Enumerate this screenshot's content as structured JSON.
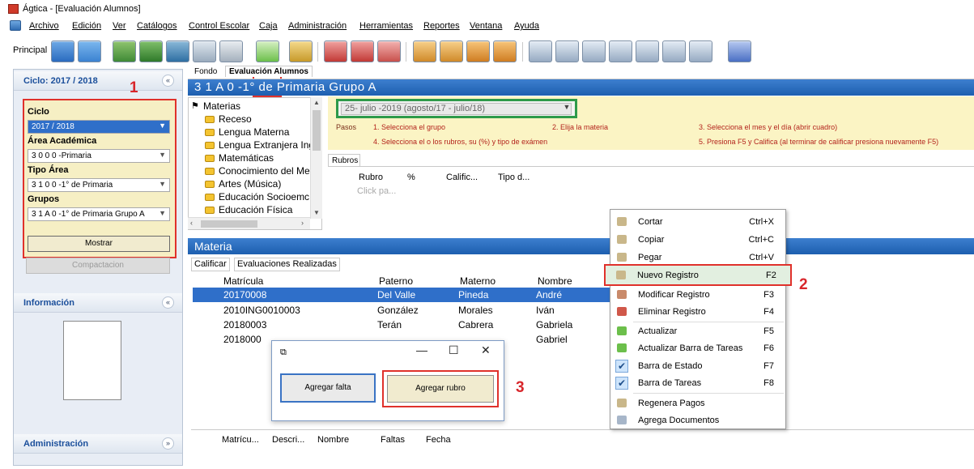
{
  "window": {
    "title": "Ágtica - [Evaluación Alumnos]"
  },
  "menu": [
    "Archivo",
    "Edición",
    "Ver",
    "Catálogos",
    "Control Escolar",
    "Caja",
    "Administración",
    "Herramientas",
    "Reportes",
    "Ventana",
    "Ayuda"
  ],
  "toolbar": {
    "label": "Principal"
  },
  "left_panel": {
    "cycle_header": "Ciclo: 2017 / 2018",
    "fields": {
      "ciclo_label": "Ciclo",
      "ciclo_value": "2017 / 2018",
      "area_label": "Área Académica",
      "area_value": "3 0 0 0 -Primaria",
      "tipo_label": "Tipo Área",
      "tipo_value": "3 1 0 0 -1° de Primaria",
      "grupos_label": "Grupos",
      "grupos_value": "3 1 A 0 -1° de Primaria Grupo A"
    },
    "mostrar": "Mostrar",
    "compactacion": "Compactacion",
    "info_header": "Información",
    "admin_header": "Administración"
  },
  "annotations": {
    "one": "1",
    "two": "2",
    "three": "3"
  },
  "main": {
    "tabs": [
      "Fondo",
      "Evaluación Alumnos"
    ],
    "group_header": "3 1 A 0 -1° de Primaria Grupo A",
    "tree_root": "Materias",
    "tree_items": [
      "Receso",
      "Lengua Materna",
      "Lengua Extranjera Ing",
      "Matemáticas",
      "Conocimiento del Me",
      "Artes (Música)",
      "Educación Socioemc",
      "Educación Física"
    ],
    "date_select": "25-     julio     -2019 (agosto/17 - julio/18)",
    "steps": {
      "pasos": "Pasos",
      "s1": "1.   Selecciona el grupo",
      "s2": "2.   Elija la materia",
      "s3": "3.     Selecciona el mes y el día (abrir cuadro)",
      "s4": "4.   Selecciona el o los rubros, su (%) y tipo de exámen",
      "s5": "5.   Presiona F5 y Califica (al terminar de calificar presiona nuevamente F5)"
    },
    "rubros_tab": "Rubros",
    "rubros_columns": [
      "Rubro",
      "%",
      "Calific...",
      "Tipo d..."
    ],
    "rubros_click": "Click pa...",
    "materia_header": "Materia",
    "subtabs": [
      "Calificar",
      "Evaluaciones Realizadas"
    ],
    "grid_columns": [
      "Matrícula",
      "Paterno",
      "Materno",
      "Nombre"
    ],
    "grid_rows": [
      [
        "20170008",
        "Del Valle",
        "Pineda",
        "André"
      ],
      [
        "2010ING0010003",
        "González",
        "Morales",
        "Iván"
      ],
      [
        "20180003",
        "Terán",
        "Cabrera",
        "Gabriela"
      ],
      [
        "2018000",
        "",
        "",
        "Gabriel"
      ]
    ],
    "bottom_columns": [
      "Matrícu...",
      "Descri...",
      "Nombre",
      "Faltas",
      "Fecha"
    ]
  },
  "dialog": {
    "minimize": "—",
    "maximize": "☐",
    "close": "✕",
    "agregar_falta": "Agregar falta",
    "agregar_rubro": "Agregar rubro"
  },
  "context_menu": {
    "items": [
      {
        "label": "Cortar",
        "shortcut": "Ctrl+X"
      },
      {
        "label": "Copiar",
        "shortcut": "Ctrl+C"
      },
      {
        "label": "Pegar",
        "shortcut": "Ctrl+V"
      },
      {
        "label": "Nuevo Registro",
        "shortcut": "F2"
      },
      {
        "label": "Modificar Registro",
        "shortcut": "F3"
      },
      {
        "label": "Eliminar Registro",
        "shortcut": "F4"
      },
      {
        "label": "Actualizar",
        "shortcut": "F5"
      },
      {
        "label": "Actualizar Barra de Tareas",
        "shortcut": "F6"
      },
      {
        "label": "Barra de Estado",
        "shortcut": "F7"
      },
      {
        "label": "Barra de Tareas",
        "shortcut": "F8"
      },
      {
        "label": "Regenera Pagos",
        "shortcut": ""
      },
      {
        "label": "Agrega Documentos",
        "shortcut": ""
      }
    ]
  },
  "colors": {
    "accent_blue": "#1d5faf",
    "highlight_red": "#e0312b",
    "highlight_green": "#2e9a4a",
    "yellow_panel": "#fbf4c4"
  }
}
